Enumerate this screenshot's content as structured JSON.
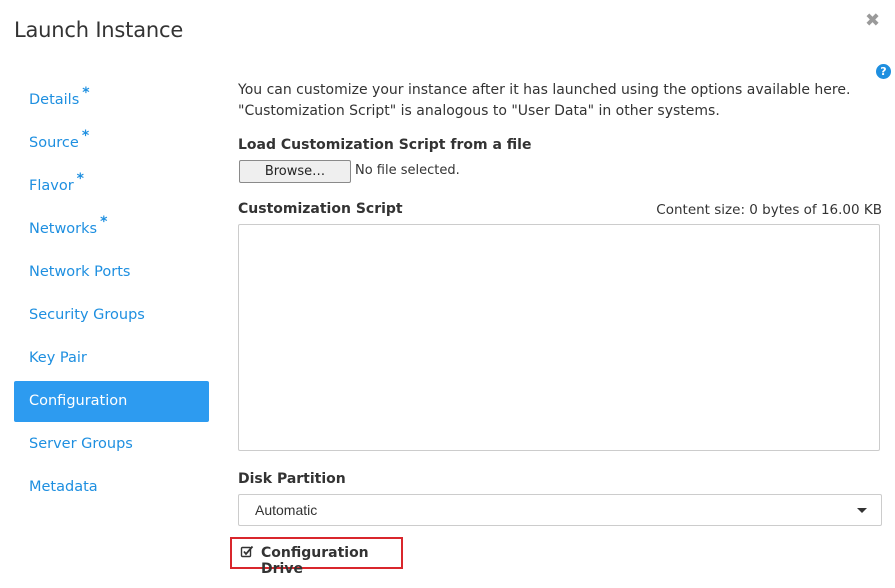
{
  "dialog": {
    "title": "Launch Instance",
    "close_icon": "close-icon",
    "help_icon": "question-circle-icon",
    "help_glyph": "?",
    "close_glyph": "✖"
  },
  "nav": {
    "items": [
      {
        "label": "Details",
        "required": "*"
      },
      {
        "label": "Source",
        "required": "*"
      },
      {
        "label": "Flavor",
        "required": "*"
      },
      {
        "label": "Networks",
        "required": "*"
      },
      {
        "label": "Network Ports",
        "required": ""
      },
      {
        "label": "Security Groups",
        "required": ""
      },
      {
        "label": "Key Pair",
        "required": ""
      },
      {
        "label": "Configuration",
        "required": "",
        "active": true
      },
      {
        "label": "Server Groups",
        "required": ""
      },
      {
        "label": "Metadata",
        "required": ""
      }
    ],
    "active_color": "#2d9bf0",
    "link_color": "#1e8fe0"
  },
  "main": {
    "intro_line1": "You can customize your instance after it has launched using the options available here.",
    "intro_line2": "\"Customization Script\" is analogous to \"User Data\" in other systems.",
    "file_label": "Load Customization Script from a file",
    "browse_label": "Browse…",
    "no_file_text": "No file selected.",
    "script_label": "Customization Script",
    "content_size": "Content size: 0 bytes of 16.00 KB",
    "script_value": "",
    "disk_label": "Disk Partition",
    "disk_value": "Automatic",
    "config_drive_label": "Configuration Drive",
    "config_drive_checked": true,
    "highlight_color": "#d9262c"
  }
}
